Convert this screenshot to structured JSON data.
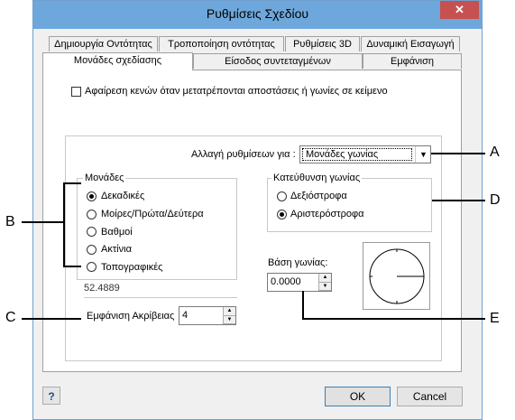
{
  "window": {
    "title": "Ρυθμίσεις Σχεδίου",
    "close_glyph": "✕"
  },
  "tabs": {
    "row1": [
      "Δημιουργία Οντότητας",
      "Τροποποίηση οντότητας",
      "Ρυθμίσεις 3D",
      "Δυναμική Εισαγωγή"
    ],
    "row2": [
      "Μονάδες σχεδίασης",
      "Είσοδος συντεταγμένων",
      "Εμφάνιση"
    ]
  },
  "options": {
    "remove_spaces_label": "Αφαίρεση κενών όταν μετατρέπονται αποστάσεις ή γωνίες σε κείμενο",
    "remove_spaces_checked": false
  },
  "change_settings": {
    "label": "Αλλαγή ρυθμίσεων για :",
    "selected": "Μονάδες γωνίας"
  },
  "units": {
    "legend": "Μονάδες",
    "items": [
      "Δεκαδικές",
      "Μοίρες/Πρώτα/Δεύτερα",
      "Βαθμοί",
      "Ακτίνια",
      "Τοπογραφικές"
    ],
    "selected_index": 0,
    "preview_value": "52.4889",
    "precision_label": "Εμφάνιση Ακρίβειας",
    "precision_value": "4"
  },
  "direction": {
    "legend": "Κατεύθυνση γωνίας",
    "items": [
      "Δεξιόστροφα",
      "Αριστερόστροφα"
    ],
    "selected_index": 1
  },
  "base_angle": {
    "label": "Βάση γωνίας:",
    "value": "0.0000"
  },
  "buttons": {
    "help": "?",
    "ok": "OK",
    "cancel": "Cancel"
  },
  "callouts": [
    "A",
    "B",
    "C",
    "D",
    "E"
  ]
}
